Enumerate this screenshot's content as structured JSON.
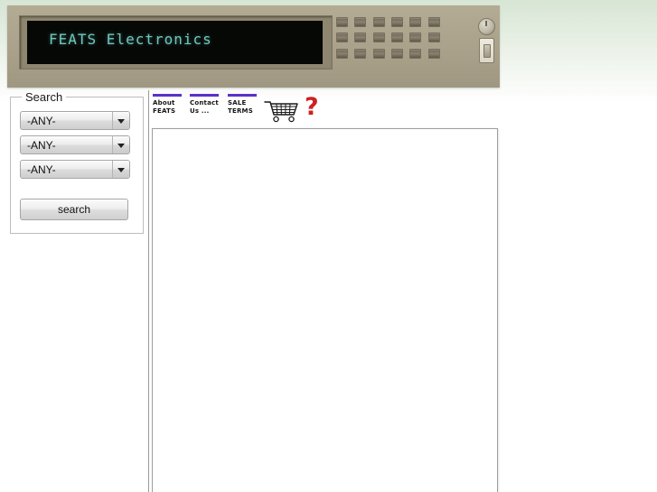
{
  "header": {
    "display_text": "FEATS Electronics",
    "display_color": "#6fc7bd",
    "faceplate_color": "#a9a189",
    "keypad_rows": 3,
    "keypad_cols": 6,
    "dial_name": "dial-knob",
    "switch_name": "power-switch"
  },
  "search": {
    "legend": "Search",
    "selects": [
      {
        "value": "-ANY-"
      },
      {
        "value": "-ANY-"
      },
      {
        "value": "-ANY-"
      }
    ],
    "button_label": "search"
  },
  "nav": {
    "links": [
      {
        "label": "About\nFEATS",
        "name": "nav-link-about-feats"
      },
      {
        "label": "Contact\nUs ...",
        "name": "nav-link-contact-us"
      },
      {
        "label": "SALE\nTERMS",
        "name": "nav-link-sale-terms"
      }
    ],
    "link_bar_color": "#5c30c8",
    "cart_icon": "shopping-cart-icon",
    "help_icon": "?",
    "help_color": "#cc2222"
  },
  "content": {
    "body_text": ""
  }
}
